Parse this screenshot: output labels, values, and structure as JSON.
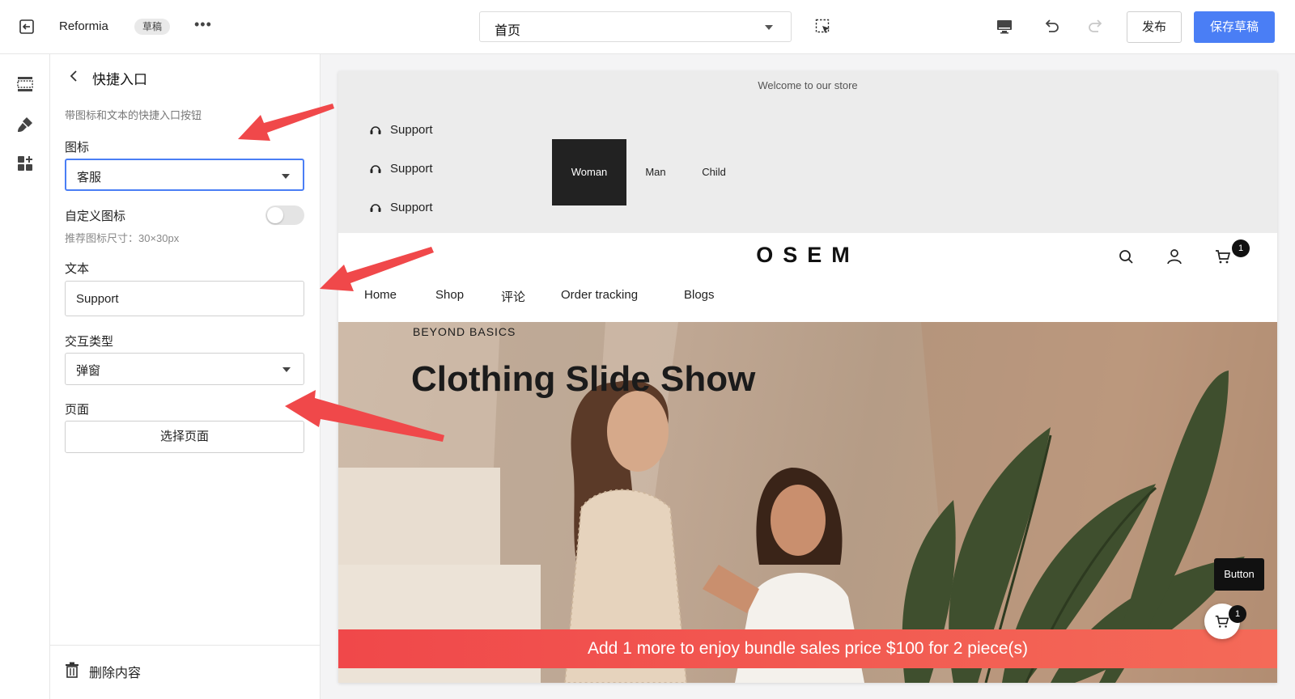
{
  "topbar": {
    "store_name": "Reformia",
    "status_badge": "草稿",
    "more_label": "•••",
    "page_select": "首页",
    "publish_label": "发布",
    "save_label": "保存草稿"
  },
  "panel": {
    "title": "快捷入口",
    "description": "带图标和文本的快捷入口按钮",
    "icon_label": "图标",
    "icon_value": "客服",
    "custom_icon_label": "自定义图标",
    "custom_icon_enabled": false,
    "icon_hint": "推荐图标尺寸：30×30px",
    "text_label": "文本",
    "text_value": "Support",
    "interaction_label": "交互类型",
    "interaction_value": "弹窗",
    "page_label": "页面",
    "page_button": "选择页面",
    "delete_label": "删除内容"
  },
  "preview": {
    "welcome": "Welcome to our store",
    "support_items": [
      "Support",
      "Support",
      "Support"
    ],
    "categories": [
      "Woman",
      "Man",
      "Child"
    ],
    "active_category": "Woman",
    "logo": "OSEM",
    "cart_count": "1",
    "nav": [
      "Home",
      "Shop",
      "评论",
      "Order tracking",
      "Blogs"
    ],
    "hero_eyebrow": "BEYOND BASICS",
    "hero_title": "Clothing Slide Show",
    "float_button": "Button",
    "float_cart_count": "1",
    "bundle_bar": "Add 1 more to enjoy bundle sales price $100 for 2 piece(s)"
  },
  "colors": {
    "accent": "#4a7ef5",
    "annotation_arrow": "#f0484a",
    "bundle_bar": "#f25a50",
    "category_active": "#222222"
  },
  "icons": [
    "exit-icon",
    "cursor-select-icon",
    "desktop-icon",
    "undo-icon",
    "redo-icon",
    "sections-icon",
    "theme-brush-icon",
    "apps-icon",
    "chevron-left-icon",
    "trash-icon",
    "headset-icon",
    "search-icon",
    "user-icon",
    "cart-icon"
  ]
}
